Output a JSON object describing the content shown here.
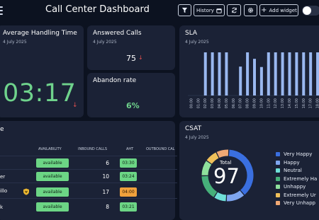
{
  "header": {
    "title": "Call Center Dashboard",
    "history_label": "History",
    "add_widget_label": "Add widget"
  },
  "aht_card": {
    "title": "Average Handling Time",
    "date": "4 July 2025",
    "value": "03:17",
    "trend": "↓"
  },
  "answered_card": {
    "title": "Answered Calls",
    "date": "4 July 2025",
    "value": "75",
    "trend": "↓"
  },
  "abandon_card": {
    "title": "Abandon rate",
    "value": "6%"
  },
  "sla_card": {
    "title": "SLA",
    "date": "4 July 2025"
  },
  "agents_card": {
    "title_fragment": "e",
    "columns": [
      "AVAILABILITY",
      "INBOUND CALLS",
      "AHT",
      "OUTBOUND CAL"
    ],
    "rows": [
      {
        "name": "",
        "availability": "available",
        "inbound": "6",
        "aht": "03:30",
        "aht_status": "green"
      },
      {
        "name": "er",
        "availability": "available",
        "inbound": "10",
        "aht": "03:24",
        "aht_status": "green"
      },
      {
        "name": "illo",
        "availability": "available",
        "inbound": "17",
        "aht": "04:00",
        "aht_status": "orange"
      },
      {
        "name": "k",
        "availability": "available",
        "inbound": "8",
        "aht": "03:21",
        "aht_status": "green"
      }
    ]
  },
  "csat_card": {
    "title": "CSAT",
    "date": "4 July 2025",
    "total_label": "Total",
    "total_value": "97",
    "legend": [
      {
        "label": "Very Happy",
        "color": "#3a6fe0"
      },
      {
        "label": "Happy",
        "color": "#7fa6f0"
      },
      {
        "label": "Neutral",
        "color": "#6fe0d8"
      },
      {
        "label": "Extremely Ha",
        "color": "#46b07a"
      },
      {
        "label": "Unhappy",
        "color": "#8ee09c"
      },
      {
        "label": "Extremely Ur",
        "color": "#f0c05a"
      },
      {
        "label": "Very Unhapp",
        "color": "#f0a874"
      }
    ]
  },
  "chart_data": {
    "type": "bar",
    "title": "SLA",
    "categories": [
      "00:00",
      "01:00",
      "02:00",
      "03:00",
      "04:00",
      "05:00",
      "06:00",
      "07:00",
      "08:00",
      "09:00",
      "10:00",
      "11:00",
      "12:00",
      "13:00",
      "14:00",
      "15:00",
      "16:00",
      "17:00",
      "18:00"
    ],
    "values": [
      0,
      0,
      100,
      100,
      100,
      100,
      0,
      67,
      100,
      85,
      66,
      100,
      100,
      100,
      100,
      100,
      100,
      100,
      100
    ],
    "ylim": [
      0,
      100
    ],
    "bar_color": "#9ab8f0"
  }
}
